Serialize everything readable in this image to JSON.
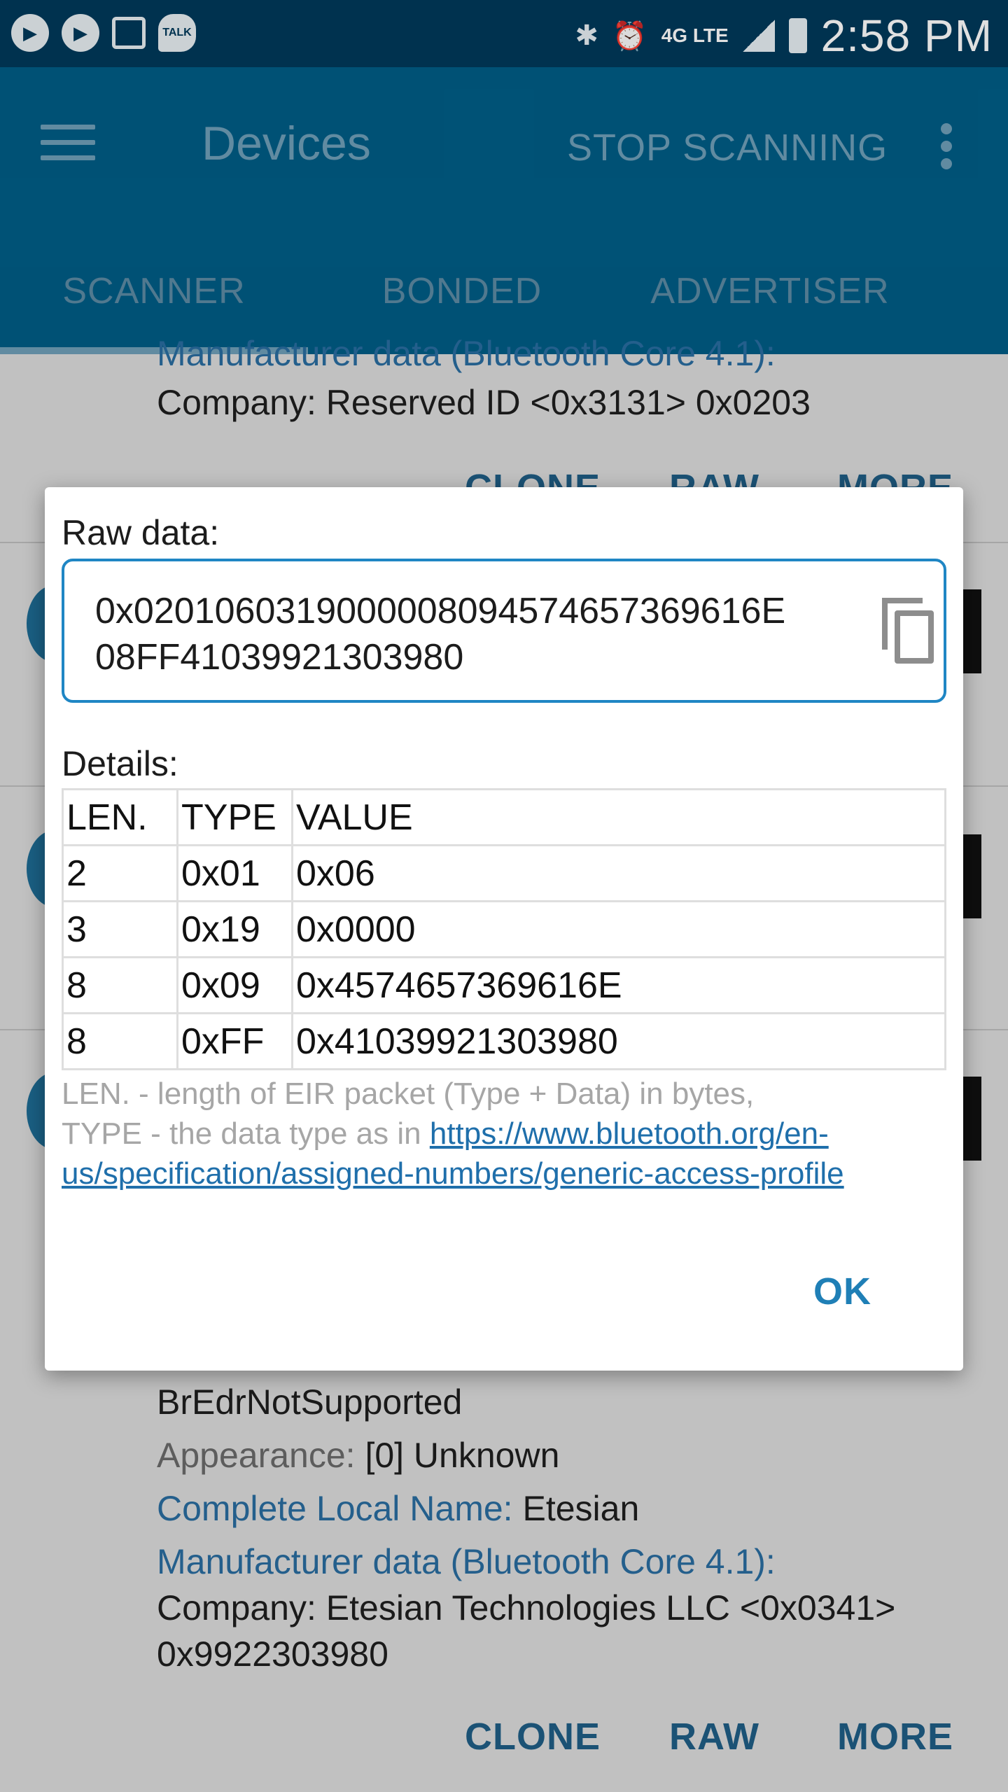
{
  "status_bar": {
    "time": "2:58 PM",
    "network": "4G LTE",
    "left_icons": [
      "play-icon",
      "play-icon",
      "image-icon",
      "talk-icon"
    ],
    "talk_label": "TALK"
  },
  "app_bar": {
    "title": "Devices",
    "action": "STOP SCANNING",
    "tabs": [
      "SCANNER",
      "BONDED",
      "ADVERTISER"
    ],
    "selected_tab": "SCANNER"
  },
  "background": {
    "top_item": {
      "manufacturer_label": "Manufacturer data (Bluetooth Core 4.1):",
      "company": "Company: Reserved ID <0x3131> 0x0203",
      "actions": [
        "CLONE",
        "RAW",
        "MORE"
      ]
    },
    "bottom_item": {
      "flags_value": "BrEdrNotSupported",
      "appearance_label": "Appearance:",
      "appearance_value": "[0] Unknown",
      "local_name_label": "Complete Local Name:",
      "local_name_value": "Etesian",
      "manufacturer_label": "Manufacturer data (Bluetooth Core 4.1):",
      "company": "Company: Etesian Technologies LLC <0x0341>",
      "company_data": "0x9922303980",
      "actions": [
        "CLONE",
        "RAW",
        "MORE"
      ]
    }
  },
  "dialog": {
    "raw_label": "Raw data:",
    "raw_value": "0x020106031900000809457465736961 6E08FF41039921303980",
    "raw_line1": "0x0201060319000008094574657369616E",
    "raw_line2": "08FF41039921303980",
    "details_label": "Details:",
    "table": {
      "headers": [
        "LEN.",
        "TYPE",
        "VALUE"
      ],
      "rows": [
        [
          "2",
          "0x01",
          "0x06"
        ],
        [
          "3",
          "0x19",
          "0x0000"
        ],
        [
          "8",
          "0x09",
          "0x4574657369616E"
        ],
        [
          "8",
          "0xFF",
          "0x41039921303980"
        ]
      ]
    },
    "note_line1": "LEN. - length of EIR packet (Type + Data) in bytes,",
    "note_line2_prefix": "TYPE - the data type as in ",
    "note_link": "https://www.bluetooth.org/en-us/specification/assigned-numbers/generic-access-profile",
    "ok_label": "OK"
  }
}
